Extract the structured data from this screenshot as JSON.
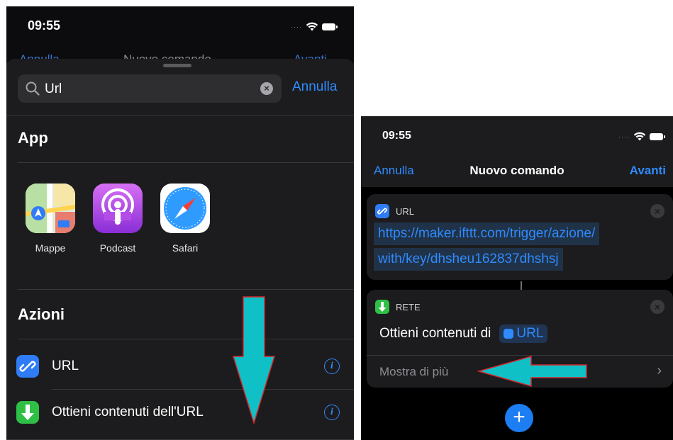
{
  "colors": {
    "accent": "#2f8bff",
    "arrow": "#0fc1c6",
    "arrow_outline": "#d3262c"
  },
  "left": {
    "status": {
      "time": "09:55"
    },
    "nav_peek": {
      "cancel": "Annulla",
      "title": "Nuovo comando",
      "next": "Avanti"
    },
    "search": {
      "value": "Url",
      "cancel": "Annulla"
    },
    "section_app": "App",
    "apps": [
      {
        "label": "Mappe",
        "icon": "maps-icon"
      },
      {
        "label": "Podcast",
        "icon": "podcast-icon"
      },
      {
        "label": "Safari",
        "icon": "safari-icon"
      }
    ],
    "section_actions": "Azioni",
    "actions": [
      {
        "label": "URL",
        "icon": "link-icon",
        "color": "#2f7cf6"
      },
      {
        "label": "Ottieni contenuti dell'URL",
        "icon": "download-arrow-icon",
        "color": "#2fbf46"
      }
    ]
  },
  "right": {
    "status": {
      "time": "09:55"
    },
    "nav": {
      "cancel": "Annulla",
      "title": "Nuovo comando",
      "next": "Avanti"
    },
    "url_card": {
      "tag": "URL",
      "lines": [
        "https://maker.ifttt.com/trigger/azione/",
        "with/key/dhsheu162837dhshsj"
      ]
    },
    "rete_card": {
      "tag": "RETE",
      "text": "Ottieni contenuti di",
      "token": "URL",
      "more": "Mostra di più"
    }
  }
}
